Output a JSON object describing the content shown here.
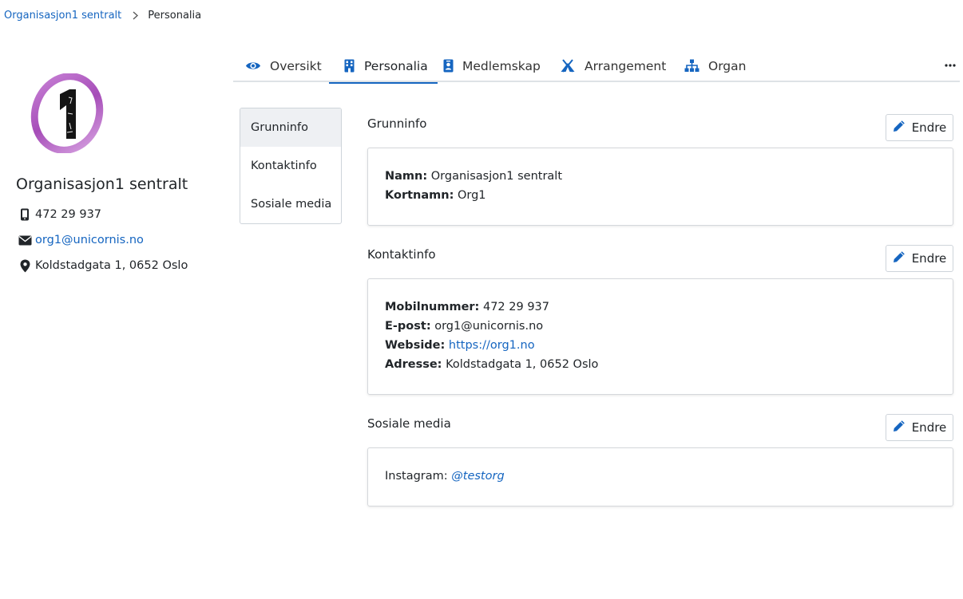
{
  "breadcrumb": {
    "parent": "Organisasjon1 sentralt",
    "current": "Personalia"
  },
  "profile": {
    "logo_icon": "org-logo-icon",
    "name": "Organisasjon1 sentralt",
    "phone": "472 29 937",
    "email": "org1@unicornis.no",
    "address": "Koldstadgata 1, 0652 Oslo"
  },
  "tabs": [
    {
      "label": "Oversikt",
      "icon": "eye-icon"
    },
    {
      "label": "Personalia",
      "icon": "building-icon"
    },
    {
      "label": "Medlemskap",
      "icon": "id-badge-icon"
    },
    {
      "label": "Arrangement",
      "icon": "campground-icon"
    },
    {
      "label": "Organ",
      "icon": "sitemap-icon"
    }
  ],
  "subnav": [
    {
      "label": "Grunninfo"
    },
    {
      "label": "Kontaktinfo"
    },
    {
      "label": "Sosiale media"
    }
  ],
  "sections": {
    "edit_label": "Endre",
    "grunninfo": {
      "title": "Grunninfo",
      "name_label": "Namn:",
      "name_value": "Organisasjon1 sentralt",
      "short_label": "Kortnamn:",
      "short_value": "Org1"
    },
    "kontaktinfo": {
      "title": "Kontaktinfo",
      "mobile_label": "Mobilnummer:",
      "mobile_value": "472 29 937",
      "email_label": "E-post:",
      "email_value": "org1@unicornis.no",
      "web_label": "Webside:",
      "web_value": "https://org1.no",
      "address_label": "Adresse:",
      "address_value": "Koldstadgata 1, 0652 Oslo"
    },
    "sosiale": {
      "title": "Sosiale media",
      "instagram_label": "Instagram:",
      "instagram_value": "@testorg"
    }
  },
  "colors": {
    "accent": "#1565c0",
    "logo_purple": "#b05fc4",
    "text": "#212529"
  }
}
